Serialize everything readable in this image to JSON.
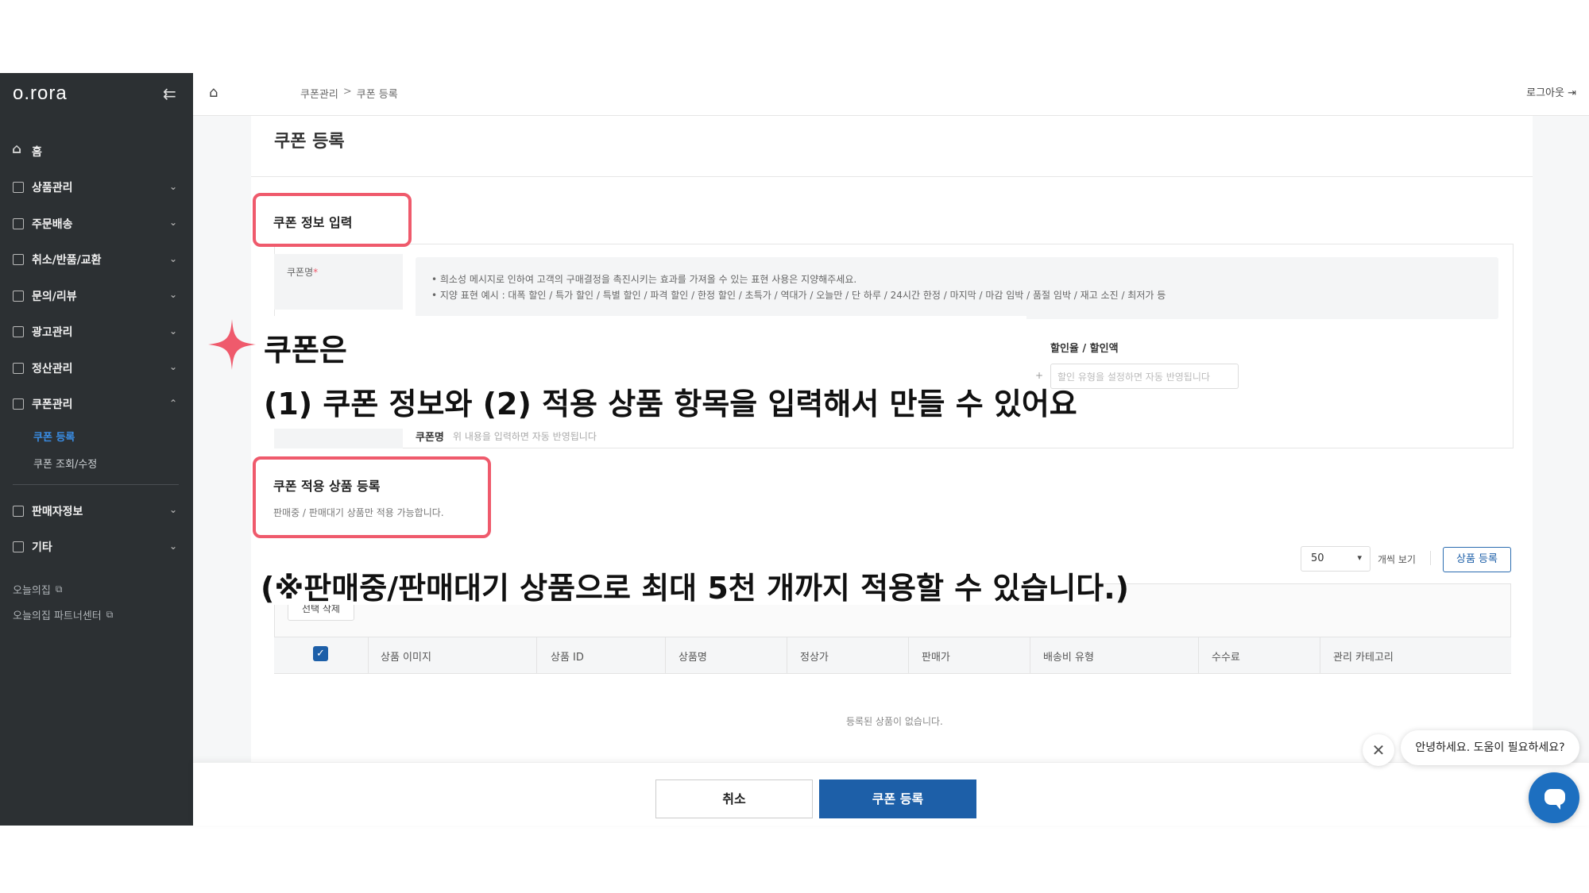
{
  "sidebar": {
    "logo": "o.rora",
    "collapse_icon": "⇇",
    "items": [
      {
        "label": "홈",
        "icon": "home-icon"
      },
      {
        "label": "상품관리",
        "icon": "doc-icon"
      },
      {
        "label": "주문배송",
        "icon": "doc-icon"
      },
      {
        "label": "취소/반품/교환",
        "icon": "doc-icon"
      },
      {
        "label": "문의/리뷰",
        "icon": "doc-icon"
      },
      {
        "label": "광고관리",
        "icon": "doc-icon"
      },
      {
        "label": "정산관리",
        "icon": "doc-icon"
      },
      {
        "label": "쿠폰관리",
        "icon": "doc-icon"
      },
      {
        "label": "판매자정보",
        "icon": "doc-icon"
      },
      {
        "label": "기타",
        "icon": "doc-icon"
      }
    ],
    "coupon_sub": [
      "쿠폰 등록",
      "쿠폰 조회/수정"
    ],
    "links": [
      "오늘의집",
      "오늘의집 파트너센터"
    ]
  },
  "topbar": {
    "breadcrumb": [
      "쿠폰관리",
      "쿠폰 등록"
    ],
    "breadcrumb_sep": ">",
    "logout": "로그아웃"
  },
  "page": {
    "title": "쿠폰 등록",
    "section1_title": "쿠폰 정보 입력",
    "coupon_name_label": "쿠폰명",
    "required_mark": "*",
    "notice_lines": [
      "• 희소성 메시지로 인하여 고객의 구매결정을 촉진시키는 효과를 가져올 수 있는 표현 사용은 지양해주세요.",
      "• 지양 표현 예시 : 대폭 할인 / 특가 할인 / 특별 할인 / 파격 할인 / 한정 할인 / 초특가 / 역대가 / 오늘만 / 단 하루 / 24시간 한정 / 마지막 / 마감 임박 / 품절 임박 / 재고 소진 / 최저가 등"
    ],
    "discount_label": "할인율 / 할인액",
    "discount_plus": "+",
    "discount_placeholder": "할인 유형을 설정하면 자동 반영됩니다",
    "name_row_label": "쿠폰명",
    "name_row_placeholder": "위 내용을 입력하면 자동 반영됩니다",
    "section2_title": "쿠폰 적용 상품 등록",
    "section2_sub": "판매중 / 판매대기 상품만 적용 가능합니다.",
    "page_size": "50",
    "view_label": "개씩 보기",
    "register_product_btn": "상품 등록",
    "delete_selected_btn": "선택 삭제",
    "table_headers": [
      "상품 이미지",
      "상품 ID",
      "상품명",
      "정상가",
      "판매가",
      "배송비 유형",
      "수수료",
      "관리 카테고리"
    ],
    "empty_msg": "등록된 상품이 없습니다.",
    "cancel_btn": "취소",
    "submit_btn": "쿠폰 등록"
  },
  "annotation": {
    "line1": "쿠폰은",
    "line2": "(1) 쿠폰 정보와 (2) 적용 상품 항목을 입력해서 만들 수 있어요",
    "line3": "(※판매중/판매대기 상품으로 최대 5천 개까지 적용할 수 있습니다.)",
    "highlight_color": "#ef5a6c"
  },
  "chat": {
    "greeting": "안녕하세요. 도움이 필요하세요?",
    "close_icon": "✕"
  },
  "colors": {
    "sidebar_bg": "#2c3033",
    "primary": "#1d5fa8",
    "active_link": "#3a8ee6"
  }
}
